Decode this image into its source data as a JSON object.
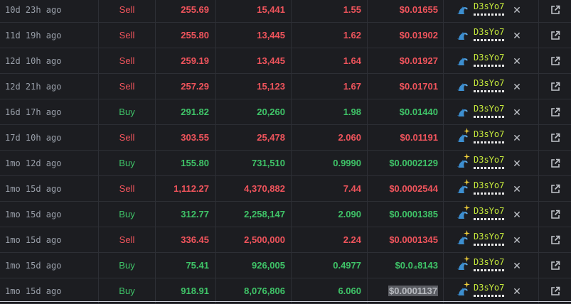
{
  "trades": [
    {
      "time": "10d 23h ago",
      "type": "Sell",
      "usd": "255.69",
      "tokens": "15,441",
      "sol": "1.55",
      "price": "$0.01655",
      "maker": "D3sYo7",
      "sparkle": false,
      "hl": false
    },
    {
      "time": "11d 19h ago",
      "type": "Sell",
      "usd": "255.80",
      "tokens": "13,445",
      "sol": "1.62",
      "price": "$0.01902",
      "maker": "D3sYo7",
      "sparkle": false,
      "hl": false
    },
    {
      "time": "12d 10h ago",
      "type": "Sell",
      "usd": "259.19",
      "tokens": "13,445",
      "sol": "1.64",
      "price": "$0.01927",
      "maker": "D3sYo7",
      "sparkle": false,
      "hl": false
    },
    {
      "time": "12d 21h ago",
      "type": "Sell",
      "usd": "257.29",
      "tokens": "15,123",
      "sol": "1.67",
      "price": "$0.01701",
      "maker": "D3sYo7",
      "sparkle": false,
      "hl": false
    },
    {
      "time": "16d 17h ago",
      "type": "Buy",
      "usd": "291.82",
      "tokens": "20,260",
      "sol": "1.98",
      "price": "$0.01440",
      "maker": "D3sYo7",
      "sparkle": false,
      "hl": false
    },
    {
      "time": "17d 10h ago",
      "type": "Sell",
      "usd": "303.55",
      "tokens": "25,478",
      "sol": "2.060",
      "price": "$0.01191",
      "maker": "D3sYo7",
      "sparkle": true,
      "hl": false
    },
    {
      "time": "1mo 12d ago",
      "type": "Buy",
      "usd": "155.80",
      "tokens": "731,510",
      "sol": "0.9990",
      "price": "$0.0002129",
      "maker": "D3sYo7",
      "sparkle": true,
      "hl": false
    },
    {
      "time": "1mo 15d ago",
      "type": "Sell",
      "usd": "1,112.27",
      "tokens": "4,370,882",
      "sol": "7.44",
      "price": "$0.0002544",
      "maker": "D3sYo7",
      "sparkle": true,
      "hl": false
    },
    {
      "time": "1mo 15d ago",
      "type": "Buy",
      "usd": "312.77",
      "tokens": "2,258,147",
      "sol": "2.090",
      "price": "$0.0001385",
      "maker": "D3sYo7",
      "sparkle": true,
      "hl": false
    },
    {
      "time": "1mo 15d ago",
      "type": "Sell",
      "usd": "336.45",
      "tokens": "2,500,000",
      "sol": "2.24",
      "price": "$0.0001345",
      "maker": "D3sYo7",
      "sparkle": true,
      "hl": false
    },
    {
      "time": "1mo 15d ago",
      "type": "Buy",
      "usd": "75.41",
      "tokens": "926,005",
      "sol": "0.4977",
      "price": "$0.0₄8143",
      "maker": "D3sYo7",
      "sparkle": true,
      "hl": false
    },
    {
      "time": "1mo 15d ago",
      "type": "Buy",
      "usd": "918.91",
      "tokens": "8,076,806",
      "sol": "6.060",
      "price": "$0.0001137",
      "maker": "D3sYo7",
      "sparkle": true,
      "hl": true
    }
  ],
  "icons": {
    "maker": "dolphin-icon",
    "sparkle": "sparkle-icon",
    "remove": "close-icon",
    "link": "external-link-icon"
  },
  "colors": {
    "sell": "#f0545c",
    "buy": "#3fc468",
    "maker": "#c6ea3c",
    "background": "#1c1d21"
  }
}
